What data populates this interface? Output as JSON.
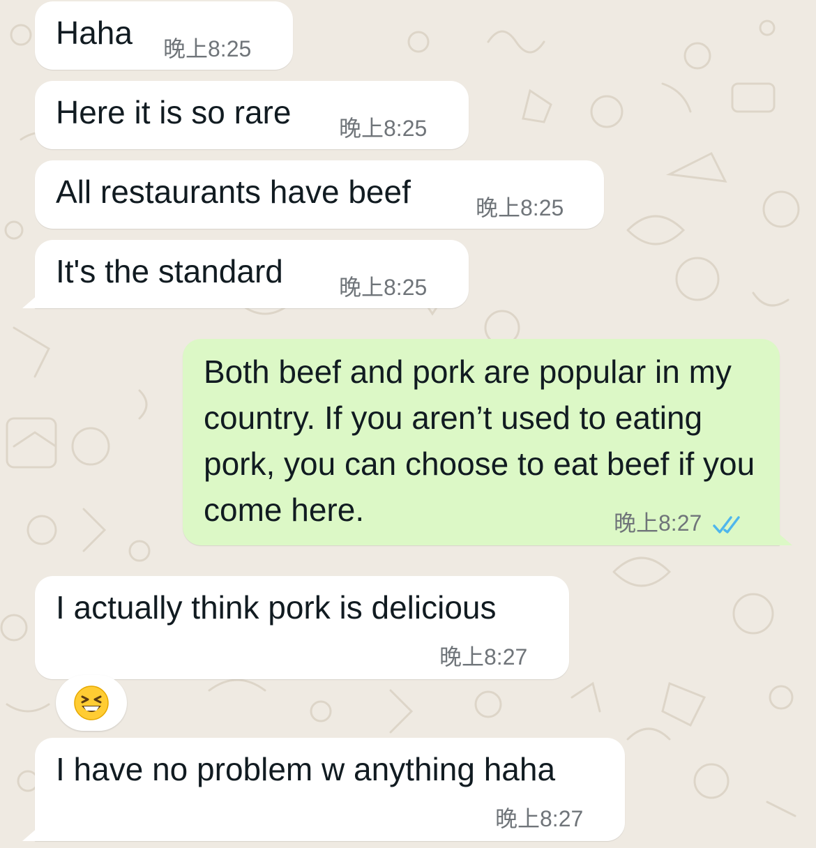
{
  "messages": [
    {
      "text": "Haha",
      "time": "晚上8:25",
      "direction": "in"
    },
    {
      "text": "Here it is so rare",
      "time": "晚上8:25",
      "direction": "in"
    },
    {
      "text": "All restaurants have beef",
      "time": "晚上8:25",
      "direction": "in"
    },
    {
      "text": "It's the standard",
      "time": "晚上8:25",
      "direction": "in"
    },
    {
      "text": "Both beef and pork are popular in my country. If you aren’t used to eating pork, you can choose to eat beef if you come here.",
      "time": "晚上8:27",
      "direction": "out",
      "status": "read"
    },
    {
      "text": "I actually think pork is delicious",
      "time": "晚上8:27",
      "direction": "in"
    },
    {
      "text": "I have no problem w anything haha",
      "time": "晚上8:27",
      "direction": "in"
    }
  ],
  "reaction": {
    "emoji": "grinning-squinting-face"
  },
  "colors": {
    "background": "#efeae2",
    "incoming": "#ffffff",
    "outgoing": "#dcf8c6",
    "read_ticks": "#4fb6ec",
    "meta": "#6f7479"
  }
}
